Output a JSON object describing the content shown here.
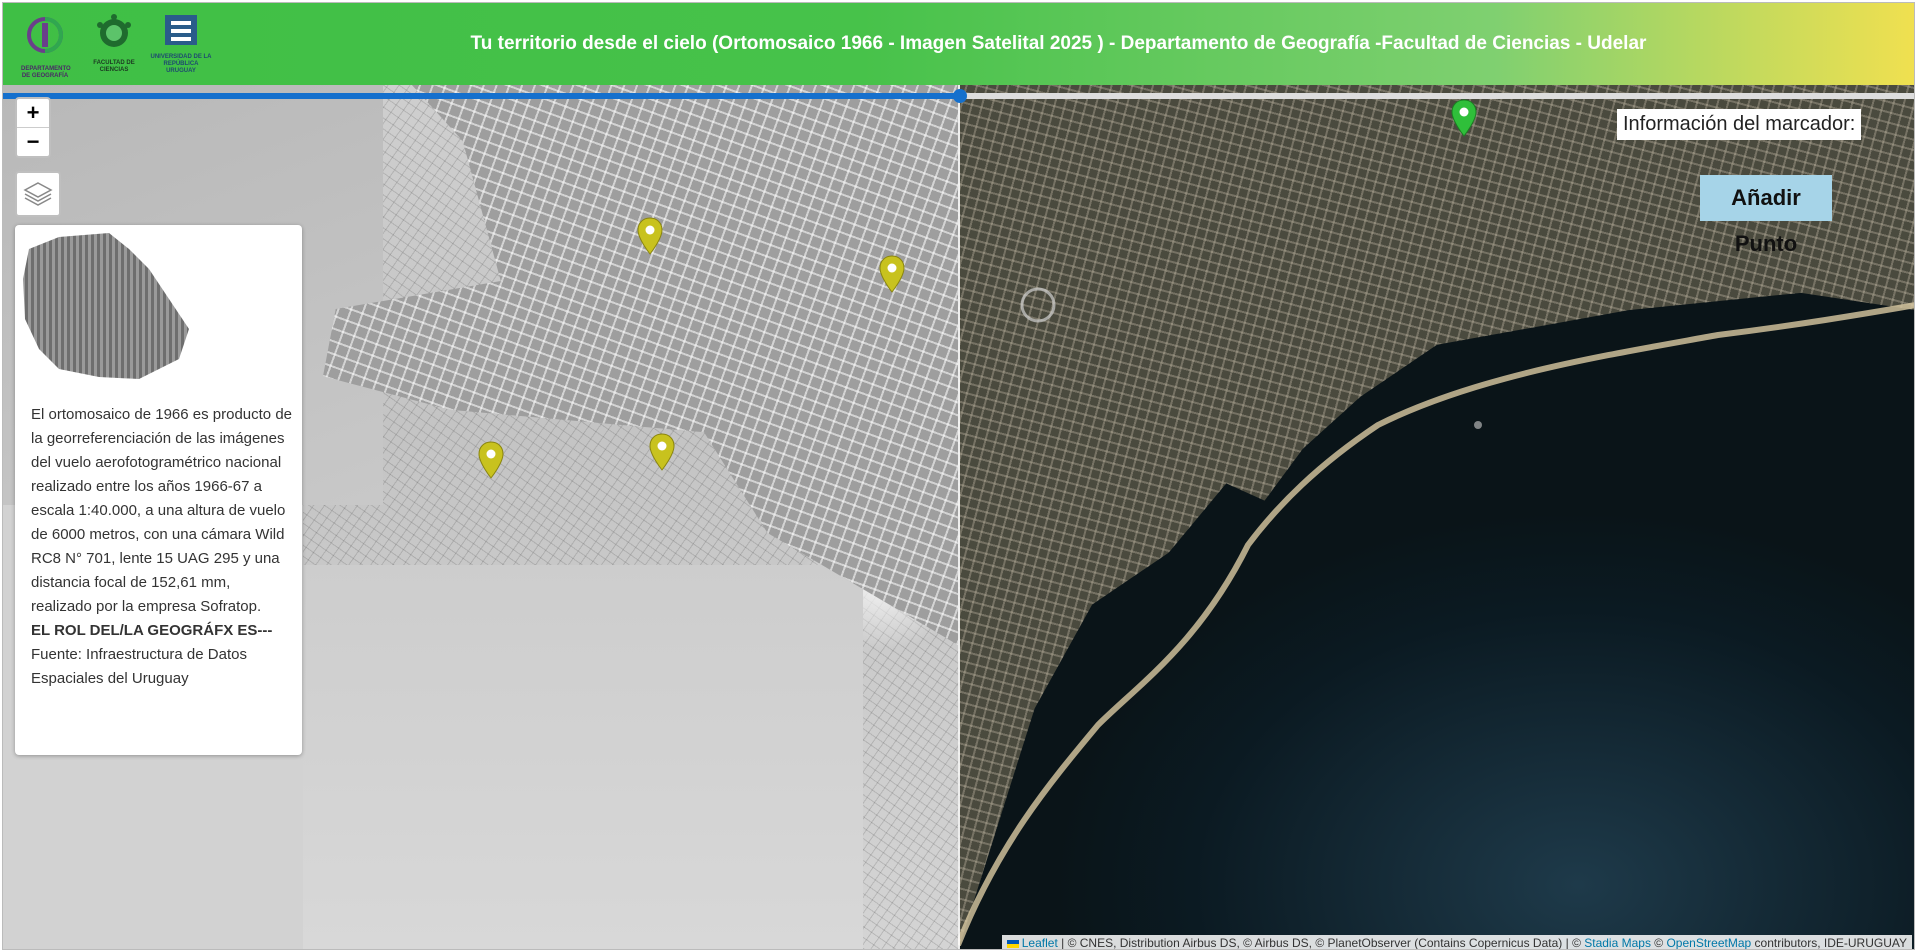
{
  "header": {
    "title": "Tu territorio desde el cielo (Ortomosaico 1966 - Imagen Satelital 2025 ) - Departamento de Geografía -Facultad de Ciencias - Udelar",
    "logos": [
      {
        "name": "departamento-geografia-logo",
        "text": "DEPARTAMENTO DE GEOGRAFÍA"
      },
      {
        "name": "facultad-ciencias-logo",
        "text": "FACULTAD DE CIENCIAS"
      },
      {
        "name": "universidad-republica-logo",
        "text": "UNIVERSIDAD DE LA REPÚBLICA URUGUAY"
      }
    ]
  },
  "map": {
    "zoom_in": "+",
    "zoom_out": "−",
    "layers_icon": "layers-icon",
    "compare_split_fraction": 0.5
  },
  "info_panel": {
    "description": "El ortomosaico de 1966 es producto de la georreferenciación de las imágenes del vuelo aerofotogramétrico nacional realizado entre los años 1966-67 a escala 1:40.000, a una altura de vuelo de 6000 metros, con una cámara Wild RC8 N° 701, lente 15 UAG 295 y una distancia focal de 152,61 mm, realizado por la empresa Sofratop.",
    "bold_line": "EL ROL DEL/LA GEOGRÁFX ES---",
    "source": " Fuente: Infraestructura de Datos Espaciales del Uruguay"
  },
  "marker_info": {
    "label": "Información del marcador:"
  },
  "add_point": {
    "label": "Añadir Punto"
  },
  "attribution": {
    "leaflet": "Leaflet",
    "text1": " | © CNES, Distribution Airbus DS, © Airbus DS, © PlanetObserver (Contains Copernicus Data) | © ",
    "stadia": "Stadia Maps",
    "text2": " © ",
    "osm": "OpenStreetMap",
    "text3": " contributors, IDE-URUGUAY"
  },
  "colors": {
    "marker_yellow": "#c8c21e",
    "marker_green": "#2fbf3a",
    "slider_blue": "#1570cd"
  }
}
